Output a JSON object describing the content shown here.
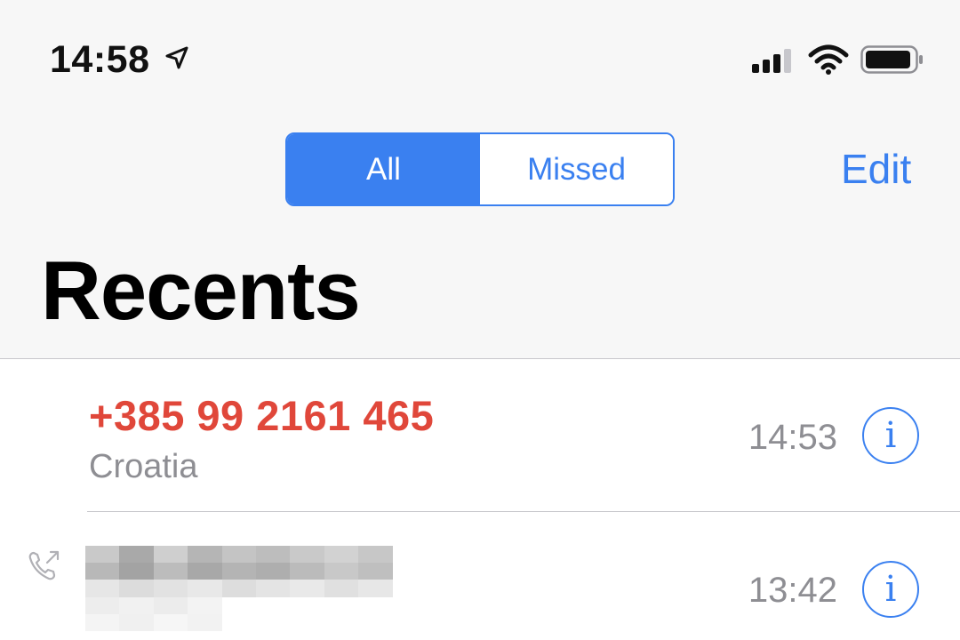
{
  "status_bar": {
    "time": "14:58",
    "location_icon": "location-arrow-icon",
    "signal_icon": "cellular-signal-icon",
    "wifi_icon": "wifi-icon",
    "battery_icon": "battery-icon"
  },
  "segmented_control": {
    "options": [
      {
        "label": "All",
        "selected": true
      },
      {
        "label": "Missed",
        "selected": false
      }
    ]
  },
  "header": {
    "edit_label": "Edit",
    "title": "Recents"
  },
  "calls": [
    {
      "number": "+385 99 2161 465",
      "location": "Croatia",
      "time": "14:53",
      "missed": true,
      "info_icon": "info-icon"
    },
    {
      "number": "",
      "location": "",
      "time": "13:42",
      "missed": false,
      "outgoing_icon": "outgoing-call-icon",
      "info_icon": "info-icon"
    }
  ],
  "colors": {
    "accent": "#3a80f0",
    "missed": "#e0473a",
    "secondary_text": "#8e8e93",
    "header_bg": "#f7f7f7"
  }
}
